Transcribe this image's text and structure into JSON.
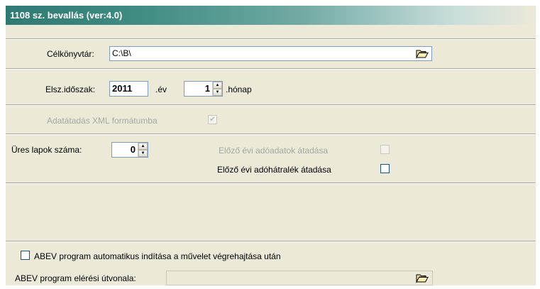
{
  "title": "1108 sz. bevallás (ver:4.0)",
  "target_dir": {
    "label": "Célkönyvtár:",
    "value": "C:\\B\\"
  },
  "period": {
    "label": "Elsz.időszak:",
    "year": "2011",
    "year_suffix": ".év",
    "month": "1",
    "month_suffix": ".hónap"
  },
  "xml_export": {
    "label": "Adatátadás XML formátumba",
    "checked": true,
    "enabled": false
  },
  "empty_pages": {
    "label": "Üres lapok száma:",
    "value": "0"
  },
  "prev_year_data": {
    "label": "Előző évi adóadatok átadása",
    "checked": false,
    "enabled": false
  },
  "prev_year_arrears": {
    "label": "Előző évi adóhátralék átadása",
    "checked": false,
    "enabled": true
  },
  "abev_autostart": {
    "label": "ABEV program automatikus indítása a művelet végrehajtása után",
    "checked": false
  },
  "abev_path": {
    "label": "ABEV program elérési útvonala:",
    "value": ""
  },
  "icons": {
    "folder": "folder-open-icon",
    "check": "checkmark-icon",
    "up": "arrow-up-icon",
    "down": "arrow-down-icon"
  }
}
